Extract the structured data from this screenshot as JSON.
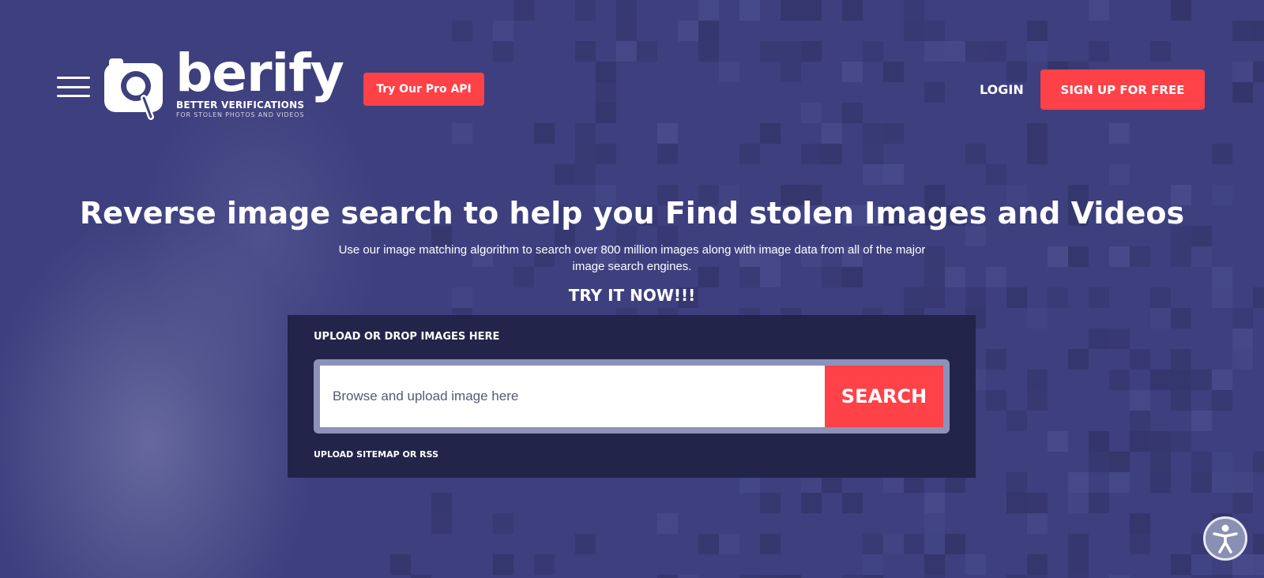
{
  "header": {
    "logo": {
      "wordmark": "berify",
      "tagline": "BETTER VERIFICATIONS",
      "subtagline": "FOR STOLEN PHOTOS AND VIDEOS"
    },
    "pro_api_label": "Try Our Pro API",
    "login_label": "LOGIN",
    "signup_label": "SIGN UP FOR FREE"
  },
  "hero": {
    "headline": "Reverse image search to help you Find stolen Images and Videos",
    "subtext": "Use our image matching algorithm to search over 800 million images along with image data from all of the major image search engines.",
    "cta": "TRY IT NOW!!!"
  },
  "upload": {
    "label": "UPLOAD OR DROP IMAGES HERE",
    "input_placeholder": "Browse and upload image here",
    "search_label": "SEARCH",
    "sitemap_label": "UPLOAD SITEMAP OR RSS"
  },
  "icons": {
    "menu": "hamburger-icon",
    "logo": "magnifier-logo-icon",
    "accessibility": "accessibility-person-icon"
  },
  "colors": {
    "background": "#3d3f7e",
    "accent": "#ff4148",
    "panel": "#222449"
  }
}
